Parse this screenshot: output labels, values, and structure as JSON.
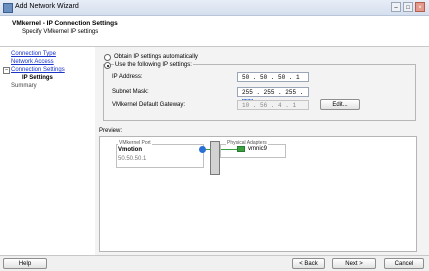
{
  "window": {
    "title": "Add Network Wizard"
  },
  "header": {
    "title": "VMkernel - IP Connection Settings",
    "subtitle": "Specify VMkernel IP settings"
  },
  "nav": {
    "items": [
      {
        "label": "Connection Type"
      },
      {
        "label": "Network Access"
      },
      {
        "label": "Connection Settings"
      },
      {
        "label": "IP Settings"
      },
      {
        "label": "Summary"
      }
    ]
  },
  "ip": {
    "auto_label": "Obtain IP settings automatically",
    "manual_label": "Use the following IP settings:",
    "address_label": "IP Address:",
    "address": [
      "50",
      "50",
      "50",
      "1"
    ],
    "mask_label": "Subnet Mask:",
    "mask": [
      "255",
      "255",
      "255",
      "255"
    ],
    "gateway_label": "VMkernel Default Gateway:",
    "gateway": [
      "10",
      "56",
      "4",
      "1"
    ],
    "edit_label": "Edit..."
  },
  "preview": {
    "label": "Preview:",
    "port_group_title": "VMkernel Port",
    "port_name": "Vmotion",
    "port_ip": "50.50.50.1",
    "adapter_group_title": "Physical Adapters",
    "adapter_name": "vmnic9"
  },
  "footer": {
    "help": "Help",
    "back": "< Back",
    "next": "Next >",
    "cancel": "Cancel"
  },
  "colors": {
    "link": "#1a33c7",
    "selection": "#3b6fd2",
    "port_icon": "#2a6fd6",
    "adapter_icon": "#3aa040"
  },
  "icons": {
    "window": "wizard-icon",
    "port": "vmkernel-port-icon",
    "adapter": "nic-icon"
  }
}
